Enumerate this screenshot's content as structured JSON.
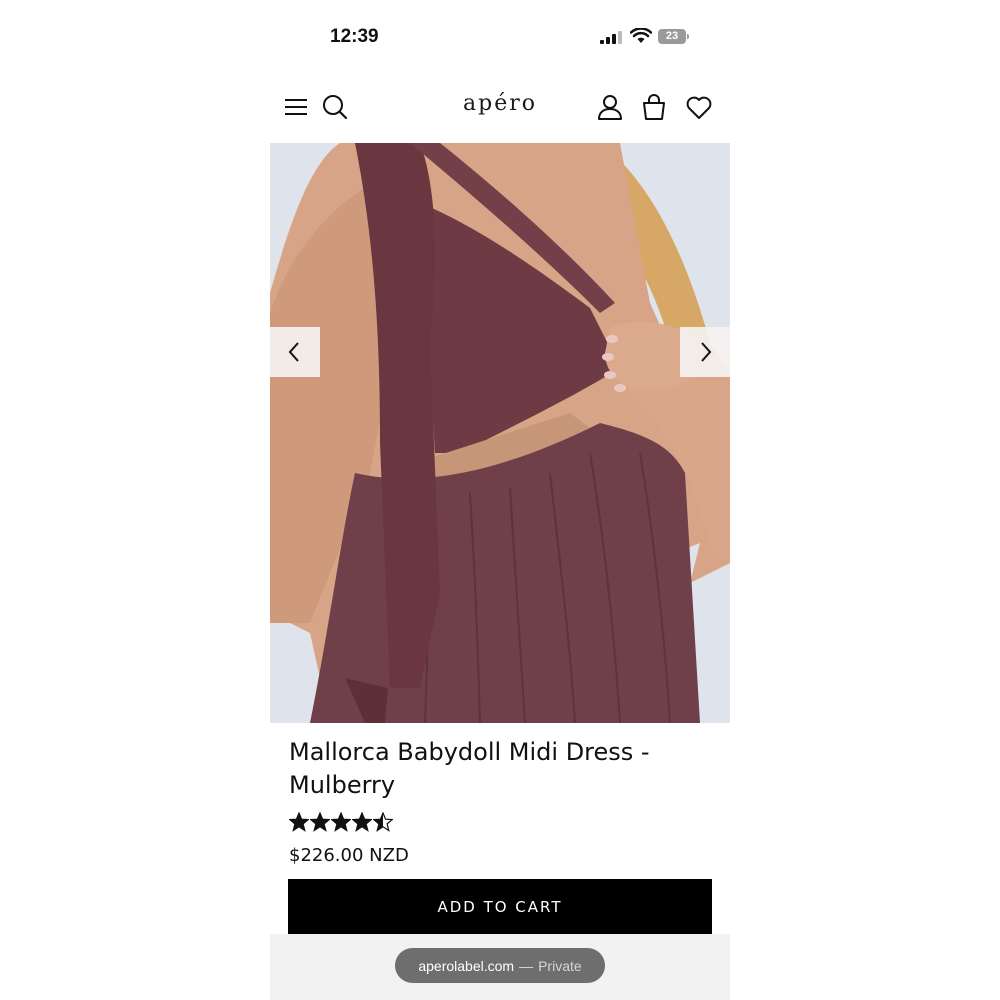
{
  "status_bar": {
    "time": "12:39",
    "battery": "23"
  },
  "header": {
    "logo": "apéro"
  },
  "product": {
    "title": "Mallorca Babydoll Midi Dress - Mulberry",
    "rating": 4.5,
    "rating_max": 5,
    "price": "$226.00 NZD",
    "add_to_cart_label": "ADD TO CART"
  },
  "browser": {
    "url": "aperolabel.com",
    "separator": "—",
    "mode": "Private"
  },
  "colors": {
    "dress": "#6e3b44",
    "button": "#000000",
    "background": "#dfe3ec"
  }
}
